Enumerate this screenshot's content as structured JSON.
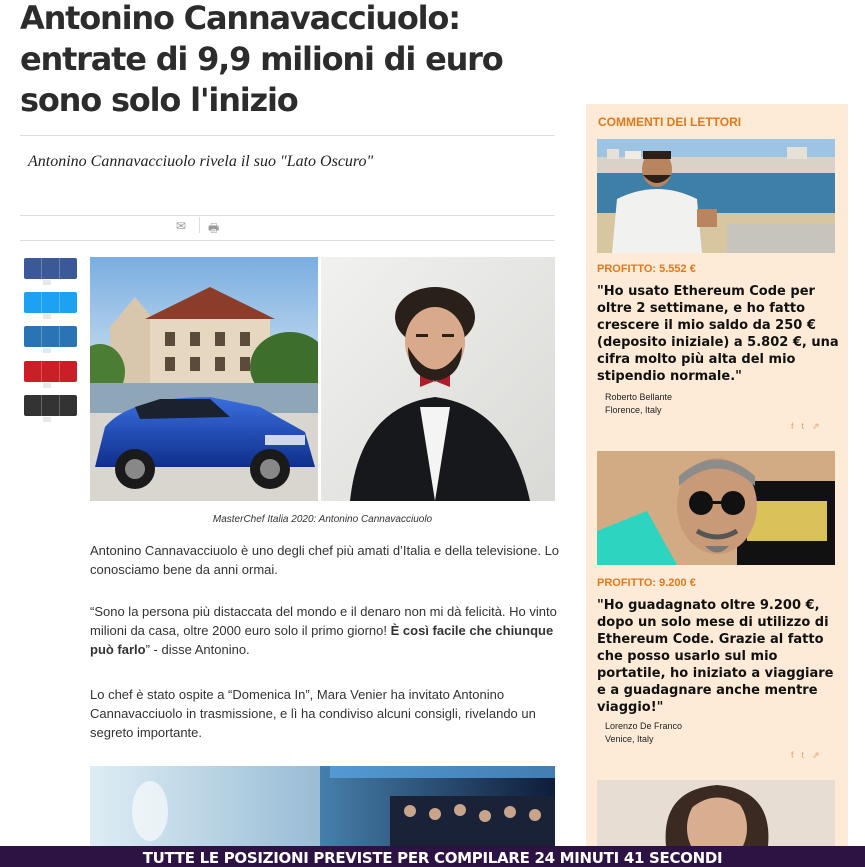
{
  "article": {
    "title": "Antonino Cannavacciuolo: entrate di 9,9 milioni di euro sono solo l'inizio",
    "subtitle": "Antonino Cannavacciuolo rivela il suo \"Lato Oscuro\"",
    "caption": "MasterChef Italia 2020: Antonino Cannavacciuolo",
    "para1": "Antonino Cannavacciuolo è uno degli chef più amati d’Italia e della televisione. Lo conosciamo bene da anni ormai.",
    "para2_a": "“Sono la persona più distaccata del mondo e il denaro non mi dà felicità. Ho vinto milioni da casa, oltre 2000 euro solo il primo giorno!",
    "para2_bold": "È così facile che chiunque può farlo",
    "para2_c": "” - disse Antonino.",
    "para3": "Lo chef è stato ospite a “Domenica In”, Mara Venier ha invitato Antonino Cannavacciuolo in trasmissione, e lì ha condiviso alcuni consigli, rivelando un segreto importante."
  },
  "tools": {
    "email_icon": "✉",
    "print_icon": "🖶"
  },
  "share_buttons": [
    {
      "icon": "facebook-share-icon",
      "color": "#3b5998"
    },
    {
      "icon": "twitter-share-icon",
      "color": "#1da1f2"
    },
    {
      "icon": "linkedin-share-icon",
      "color": "#2a74b5"
    },
    {
      "icon": "pinterest-share-icon",
      "color": "#cb1f27"
    },
    {
      "icon": "more-share-icon",
      "color": "#333333"
    }
  ],
  "sidebar": {
    "heading": "COMMENTI DEI LETTORI",
    "comments": [
      {
        "profit": "PROFITTO: 5.552 €",
        "quote": "\"Ho usato Ethereum Code per oltre 2 settimane, e ho fatto crescere il mio saldo da 250 € (deposito iniziale) a 5.802 €, una cifra molto più alta del mio stipendio normale.\"",
        "name": "Roberto Bellante",
        "location": "Florence, Italy"
      },
      {
        "profit": "PROFITTO: 9.200 €",
        "quote": "\"Ho guadagnato oltre 9.200 €, dopo un solo mese di utilizzo di Ethereum Code. Grazie al fatto che posso usarlo sul mio portatile, ho iniziato a viaggiare e a guadagnare anche mentre viaggio!\"",
        "name": "Lorenzo De Franco",
        "location": "Venice, Italy"
      }
    ],
    "icons": {
      "facebook": "f",
      "twitter": "t",
      "share": "⇗"
    }
  },
  "countdown": "TUTTE LE POSIZIONI PREVISTE PER COMPILARE 24 MINUTI 41 SECONDI",
  "colors": {
    "accent": "#e0781c",
    "sidebar_bg": "#fdebd7",
    "banner_bg": "#2c1344"
  }
}
